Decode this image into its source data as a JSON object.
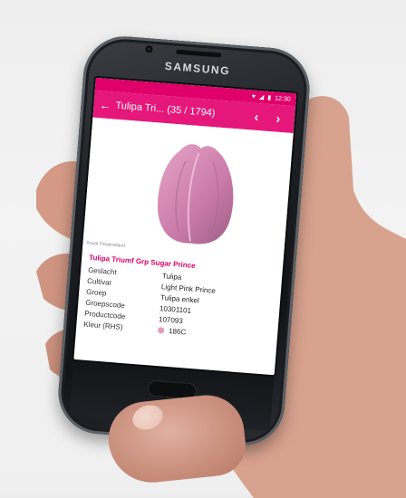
{
  "device": {
    "brand": "SAMSUNG"
  },
  "status_bar": {
    "time": "12:30",
    "icons": [
      "heart-icon",
      "signal-icon",
      "battery-icon"
    ]
  },
  "app_bar": {
    "title": "Tulipa Tri... (35 / 1794)",
    "back_icon": "arrow-left-icon",
    "prev_icon": "chevron-left-icon",
    "next_icon": "chevron-right-icon"
  },
  "product": {
    "name": "Tulipa Triumf Grp Sugar Prince",
    "logo_text": "Royal FloraHolland",
    "details": [
      {
        "label": "Geslacht",
        "value": "Tulipa"
      },
      {
        "label": "Cultivar",
        "value": "Light Pink Prince"
      },
      {
        "label": "Groep",
        "value": "Tulipa enkel"
      },
      {
        "label": "Groepscode",
        "value": "10301101"
      },
      {
        "label": "Productcode",
        "value": "107093"
      },
      {
        "label": "Kleur (RHS)",
        "value": "186C"
      }
    ]
  },
  "colors": {
    "accent": "#e6177a",
    "status": "#e0006a",
    "swatch": "#e59cb6"
  }
}
